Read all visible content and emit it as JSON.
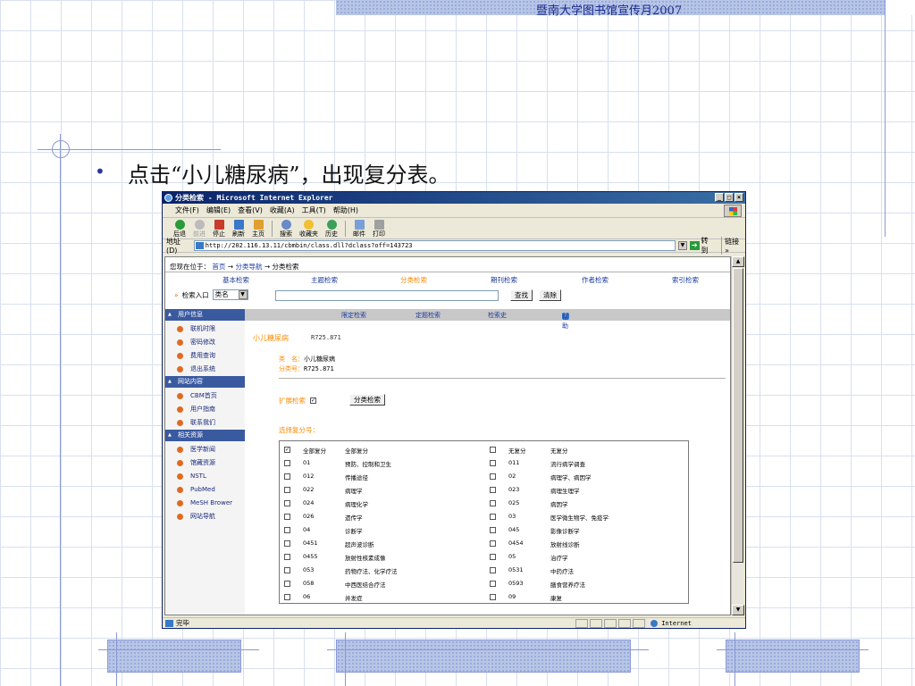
{
  "slide": {
    "header_title": "暨南大学图书馆宣传月2007",
    "bullet_text": "点击“小儿糖尿病”，出现复分表。",
    "bullet_symbol": "•"
  },
  "window": {
    "title": "分类检索 - Microsoft Internet Explorer",
    "controls": [
      "_",
      "□",
      "×"
    ],
    "menu": [
      "文件(F)",
      "编辑(E)",
      "查看(V)",
      "收藏(A)",
      "工具(T)",
      "帮助(H)"
    ],
    "toolbar": {
      "back": "后退",
      "forward": "前进",
      "stop": "停止",
      "refresh": "刷新",
      "home": "主页",
      "search": "搜索",
      "favorites": "收藏夹",
      "history": "历史",
      "mail": "邮件",
      "print": "打印"
    },
    "address_label": "地址(D)",
    "address_url": "http://202.116.13.11/cbmbin/class.dll?dclass?off=143723",
    "go_label": "转到",
    "links_label": "链接 »",
    "status_text": "完毕",
    "zone_text": "Internet"
  },
  "page": {
    "breadcrumb": {
      "prefix": "您现在位于：",
      "home": "首页",
      "arrow1": "→",
      "nav": "分类导航",
      "arrow2": "→",
      "current": "分类检索"
    },
    "main_nav": [
      "基本检索",
      "主题检索",
      "分类检索",
      "期刊检索",
      "作者检索",
      "索引检索"
    ],
    "search_entry_label": "检索入口",
    "search_select_value": "类名",
    "search_button": "查找",
    "clear_button": "清除",
    "sidebar": [
      {
        "header": "用户信息",
        "items": [
          "联机时限",
          "密码修改",
          "费用查询",
          "退出系统"
        ]
      },
      {
        "header": "网站内容",
        "items": [
          "CBM首页",
          "用户指南",
          "联系我们"
        ]
      },
      {
        "header": "相关资源",
        "items": [
          "医学新闻",
          "馆藏资源",
          "NSTL",
          "PubMed",
          "MeSH Brower",
          "网站导航"
        ]
      }
    ],
    "sub_nav": [
      "限定检索",
      "定题检索",
      "检索史",
      "帮助"
    ],
    "class_title": "小儿糖尿病",
    "class_code": "R725.871",
    "class_name_label": "类　名：",
    "class_name_value": "小儿糖尿病",
    "class_number_label": "分类号：",
    "class_number_value": "R725.871",
    "expand_label": "扩展检索",
    "expand_checked": "✓",
    "class_search_button": "分类检索",
    "select_subdivision_label": "选择复分号：",
    "subdivisions": [
      {
        "lc": "✓",
        "lcode": "全部复分",
        "lname": "全部复分",
        "rcode": "无复分",
        "rname": "无复分"
      },
      {
        "lc": "",
        "lcode": "01",
        "lname": "预防、控制和卫生",
        "rcode": "011",
        "rname": "流行病学调查"
      },
      {
        "lc": "",
        "lcode": "012",
        "lname": "传播途径",
        "rcode": "02",
        "rname": "病理学、病因学"
      },
      {
        "lc": "",
        "lcode": "022",
        "lname": "病理学",
        "rcode": "023",
        "rname": "病理生理学"
      },
      {
        "lc": "",
        "lcode": "024",
        "lname": "病理化学",
        "rcode": "025",
        "rname": "病因学"
      },
      {
        "lc": "",
        "lcode": "026",
        "lname": "遗传学",
        "rcode": "03",
        "rname": "医学微生物学、免疫学"
      },
      {
        "lc": "",
        "lcode": "04",
        "lname": "诊断学",
        "rcode": "045",
        "rname": "影像诊断学"
      },
      {
        "lc": "",
        "lcode": "0451",
        "lname": "超声波诊断",
        "rcode": "0454",
        "rname": "放射线诊断"
      },
      {
        "lc": "",
        "lcode": "0455",
        "lname": "放射性核素成像",
        "rcode": "05",
        "rname": "治疗学"
      },
      {
        "lc": "",
        "lcode": "053",
        "lname": "药物疗法、化学疗法",
        "rcode": "0531",
        "rname": "中药疗法"
      },
      {
        "lc": "",
        "lcode": "058",
        "lname": "中西医结合疗法",
        "rcode": "0593",
        "rname": "膳食营养疗法"
      },
      {
        "lc": "",
        "lcode": "06",
        "lname": "并发症",
        "rcode": "09",
        "rname": "康复"
      }
    ]
  },
  "colors": {
    "accent": "#ff8a00",
    "link": "#1a3aaa",
    "sidebar_header": "#3a5aa0",
    "titlebar": "#0a246a"
  }
}
